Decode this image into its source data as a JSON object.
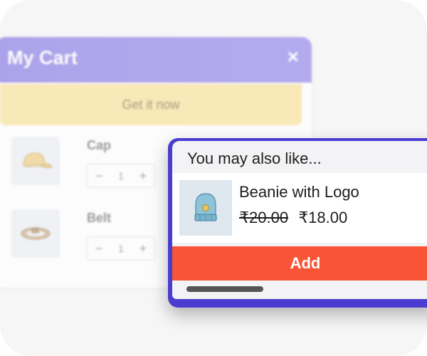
{
  "cart": {
    "title": "My Cart",
    "close_icon": "×",
    "cta_label": "Get it now",
    "items": [
      {
        "name": "Cap",
        "quantity": "1",
        "minus": "−",
        "plus": "+",
        "icon": "cap-icon"
      },
      {
        "name": "Belt",
        "quantity": "1",
        "minus": "−",
        "plus": "+",
        "icon": "belt-icon"
      }
    ],
    "colors": {
      "header": "#9387e8",
      "cta": "#fbe3a0"
    }
  },
  "upsell": {
    "heading": "You may also like...",
    "product": {
      "name": "Beanie with Logo",
      "old_price": "₹20.00",
      "new_price": "₹18.00",
      "icon": "beanie-icon"
    },
    "add_label": "Add",
    "colors": {
      "border": "#4a3ccf",
      "button": "#f75535"
    }
  }
}
